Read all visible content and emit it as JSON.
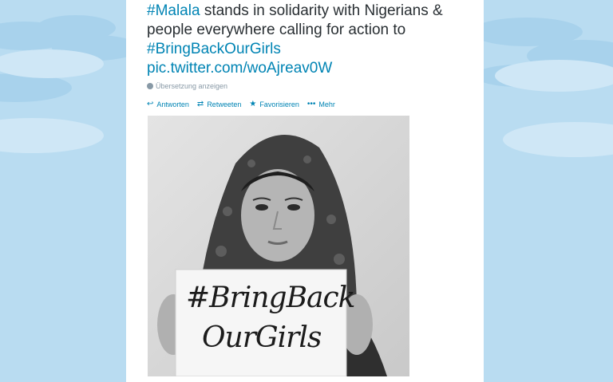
{
  "tweet": {
    "hashtag_malala": "#Malala",
    "body_text": " stands in solidarity with Nigerians & people everywhere calling for action to",
    "hashtag_bring": "#BringBackOurGirls",
    "pic_link": "pic.twitter.com/woAjreav0W",
    "translate_label": "Übersetzung anzeigen"
  },
  "actions": [
    {
      "icon": "reply-icon",
      "label": "Antworten"
    },
    {
      "icon": "retweet-icon",
      "label": "Retweeten"
    },
    {
      "icon": "star-icon",
      "label": "Favorisieren"
    },
    {
      "icon": "more-icon",
      "label": "Mehr"
    }
  ],
  "photo": {
    "sign_line1": "#BringBack",
    "sign_line2": "OurGirls"
  },
  "colors": {
    "link": "#0084b4",
    "text": "#292f33",
    "muted": "#8899a6",
    "sky": "#b7dbf0"
  }
}
